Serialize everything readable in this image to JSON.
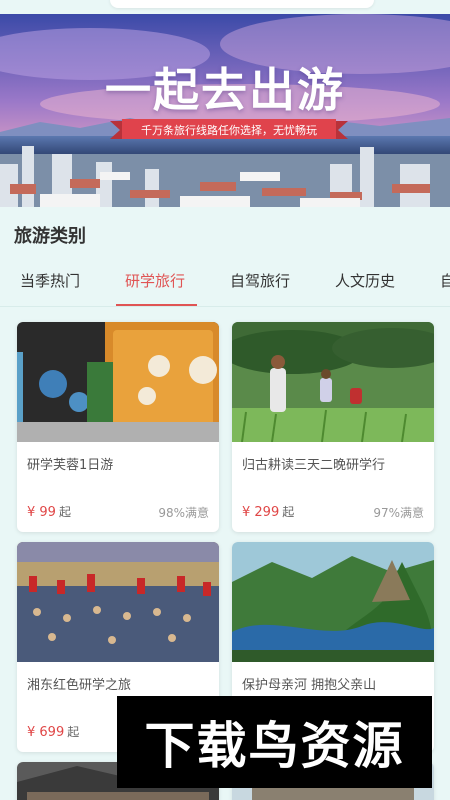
{
  "banner": {
    "title": "一起去出游",
    "subtitle": "千万条旅行线路任你选择，无忧畅玩"
  },
  "section": {
    "title": "旅游类别"
  },
  "tabs": [
    {
      "label": "当季热门",
      "active": false
    },
    {
      "label": "研学旅行",
      "active": true
    },
    {
      "label": "自驾旅行",
      "active": false
    },
    {
      "label": "人文历史",
      "active": false
    },
    {
      "label": "自",
      "active": false
    }
  ],
  "products": [
    {
      "name": "研学芙蓉1日游",
      "price": "¥ 99",
      "unit": "起",
      "satisfaction": "98%满意",
      "image": "museum-exhibit-image"
    },
    {
      "name": "归古耕读三天二晚研学行",
      "price": "¥ 299",
      "unit": "起",
      "satisfaction": "97%满意",
      "image": "child-farm-image"
    },
    {
      "name": "湘东红色研学之旅",
      "price": "¥ 699",
      "unit": "起",
      "satisfaction": "",
      "image": "red-flag-crowd-image"
    },
    {
      "name": "保护母亲河 拥抱父亲山",
      "price": "",
      "unit": "",
      "satisfaction": "",
      "image": "river-mountain-image"
    }
  ],
  "watermark": {
    "text": "下载鸟资源"
  },
  "colors": {
    "accent": "#e05454",
    "background": "#e9f7f6",
    "price": "#e04646"
  }
}
